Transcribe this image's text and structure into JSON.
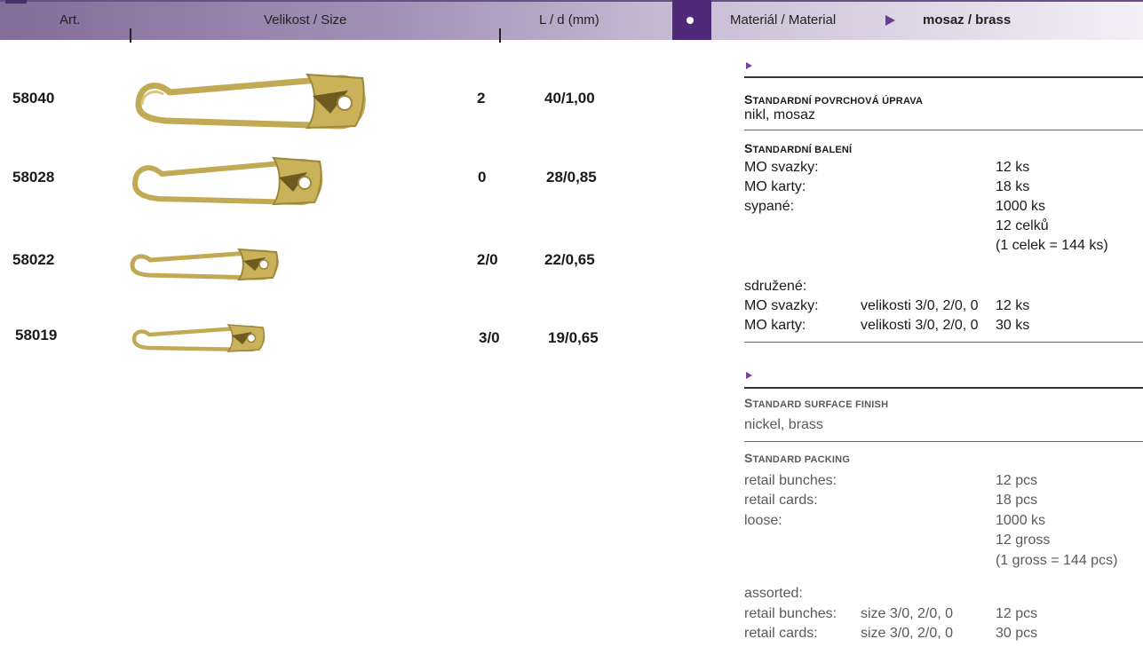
{
  "header": {
    "art": "Art.",
    "size": "Velikost / Size",
    "ld": "L / d (mm)",
    "material_label": "Materiál / Material",
    "material_value": "mosaz / brass"
  },
  "products": [
    {
      "art": "58040",
      "size": "2",
      "ld": "40/1,00"
    },
    {
      "art": "58028",
      "size": "0",
      "ld": "28/0,85"
    },
    {
      "art": "58022",
      "size": "2/0",
      "ld": "22/0,65"
    },
    {
      "art": "58019",
      "size": "3/0",
      "ld": "19/0,65"
    }
  ],
  "cz": {
    "finish_title_first": "S",
    "finish_title_rest": "TANDARDNÍ POVRCHOVÁ ÚPRAVA",
    "finish_value": "nikl, mosaz",
    "packing_title_first": "S",
    "packing_title_rest": "TANDARDNÍ BALENÍ",
    "rows": [
      {
        "label": "MO svazky:",
        "value": "12 ks"
      },
      {
        "label": "MO karty:",
        "value": "18 ks"
      },
      {
        "label": "sypané:",
        "value": "1000 ks"
      },
      {
        "label": "",
        "value": "12 celků"
      },
      {
        "label": "",
        "value": "(1 celek = 144 ks)"
      }
    ],
    "assorted_label": "sdružené:",
    "assorted_rows": [
      {
        "label": "MO svazky:",
        "sizes": "velikosti 3/0, 2/0, 0",
        "value": "12 ks"
      },
      {
        "label": "MO karty:",
        "sizes": "velikosti 3/0, 2/0, 0",
        "value": "30 ks"
      }
    ]
  },
  "en": {
    "finish_title_first": "S",
    "finish_title_rest": "TANDARD SURFACE FINISH",
    "finish_value": "nickel, brass",
    "packing_title_first": "S",
    "packing_title_rest": "TANDARD PACKING",
    "rows": [
      {
        "label": "retail bunches:",
        "value": "12 pcs"
      },
      {
        "label": "retail cards:",
        "value": "18 pcs"
      },
      {
        "label": "loose:",
        "value": "1000 ks"
      },
      {
        "label": "",
        "value": "12 gross"
      },
      {
        "label": "",
        "value": "(1 gross = 144 pcs)"
      }
    ],
    "assorted_label": "assorted:",
    "assorted_rows": [
      {
        "label": "retail bunches:",
        "sizes": "size 3/0, 2/0, 0",
        "value": "12 pcs"
      },
      {
        "label": "retail cards:",
        "sizes": "size 3/0, 2/0, 0",
        "value": "30 pcs"
      }
    ]
  },
  "colors": {
    "accent": "#4e2a78",
    "header_start": "#836d99",
    "brass": "#c9b25a"
  }
}
